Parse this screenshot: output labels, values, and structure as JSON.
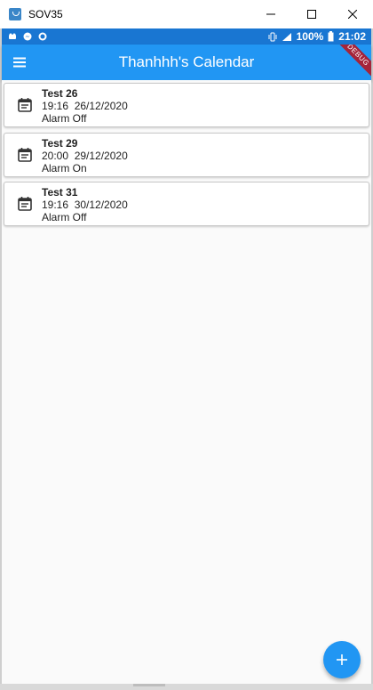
{
  "window": {
    "title": "SOV35"
  },
  "status_bar": {
    "battery_percent": "100%",
    "time": "21:02"
  },
  "app_bar": {
    "title": "Thanhhh's Calendar",
    "debug_banner": "DEBUG"
  },
  "events": [
    {
      "title": "Test 26",
      "datetime": "19:16  26/12/2020",
      "alarm": "Alarm Off"
    },
    {
      "title": "Test 29",
      "datetime": "20:00  29/12/2020",
      "alarm": "Alarm On"
    },
    {
      "title": "Test 31",
      "datetime": "19:16  30/12/2020",
      "alarm": "Alarm Off"
    }
  ],
  "fab": {
    "icon": "plus-icon"
  },
  "colors": {
    "app_bar": "#2196f3",
    "status_bar": "#1976d2",
    "background": "#fafafa"
  }
}
